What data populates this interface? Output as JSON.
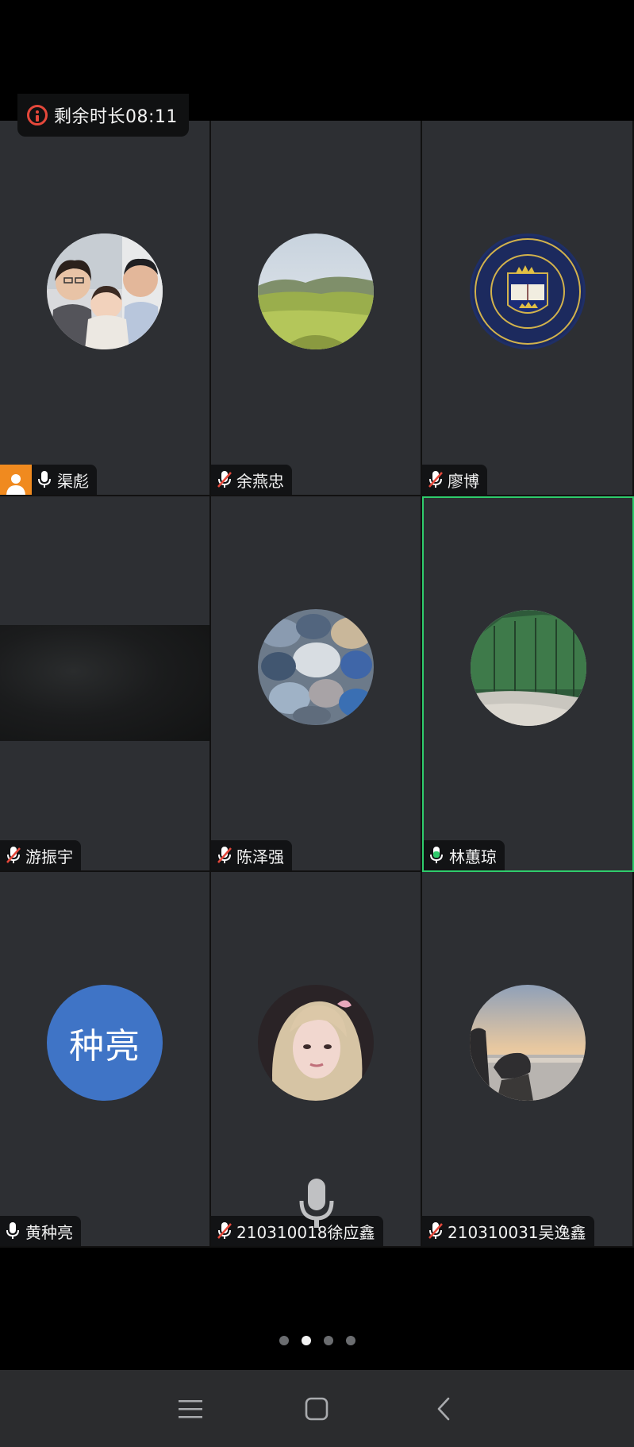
{
  "timer": {
    "label": "剩余时长08:11"
  },
  "participants": [
    {
      "name": "渠彪",
      "mic": "on",
      "host": true,
      "avatar": "family-photo"
    },
    {
      "name": "余燕忠",
      "mic": "muted",
      "avatar": "landscape-photo"
    },
    {
      "name": "廖博",
      "mic": "muted",
      "avatar": "oxford-crest"
    },
    {
      "name": "游振宇",
      "mic": "muted",
      "avatar": "video-feed"
    },
    {
      "name": "陈泽强",
      "mic": "muted",
      "avatar": "pebbles-photo"
    },
    {
      "name": "林蕙琼",
      "mic": "on-speaking",
      "active": true,
      "avatar": "forest-road-photo"
    },
    {
      "name": "黄种亮",
      "mic": "on",
      "avatar_text": "种亮"
    },
    {
      "name": "210310018徐应鑫",
      "mic": "muted",
      "avatar": "portrait-photo"
    },
    {
      "name": "210310031吴逸鑫",
      "mic": "muted",
      "avatar": "sunset-photo"
    }
  ],
  "pager": {
    "count": 4,
    "current": 2
  },
  "colors": {
    "accent_green": "#2fcc6c",
    "muted_red": "#e5483b",
    "host_orange": "#f08a1f",
    "avatar_blue": "#3f74c6"
  },
  "navbar": [
    "menu-icon",
    "home-icon",
    "back-icon"
  ]
}
